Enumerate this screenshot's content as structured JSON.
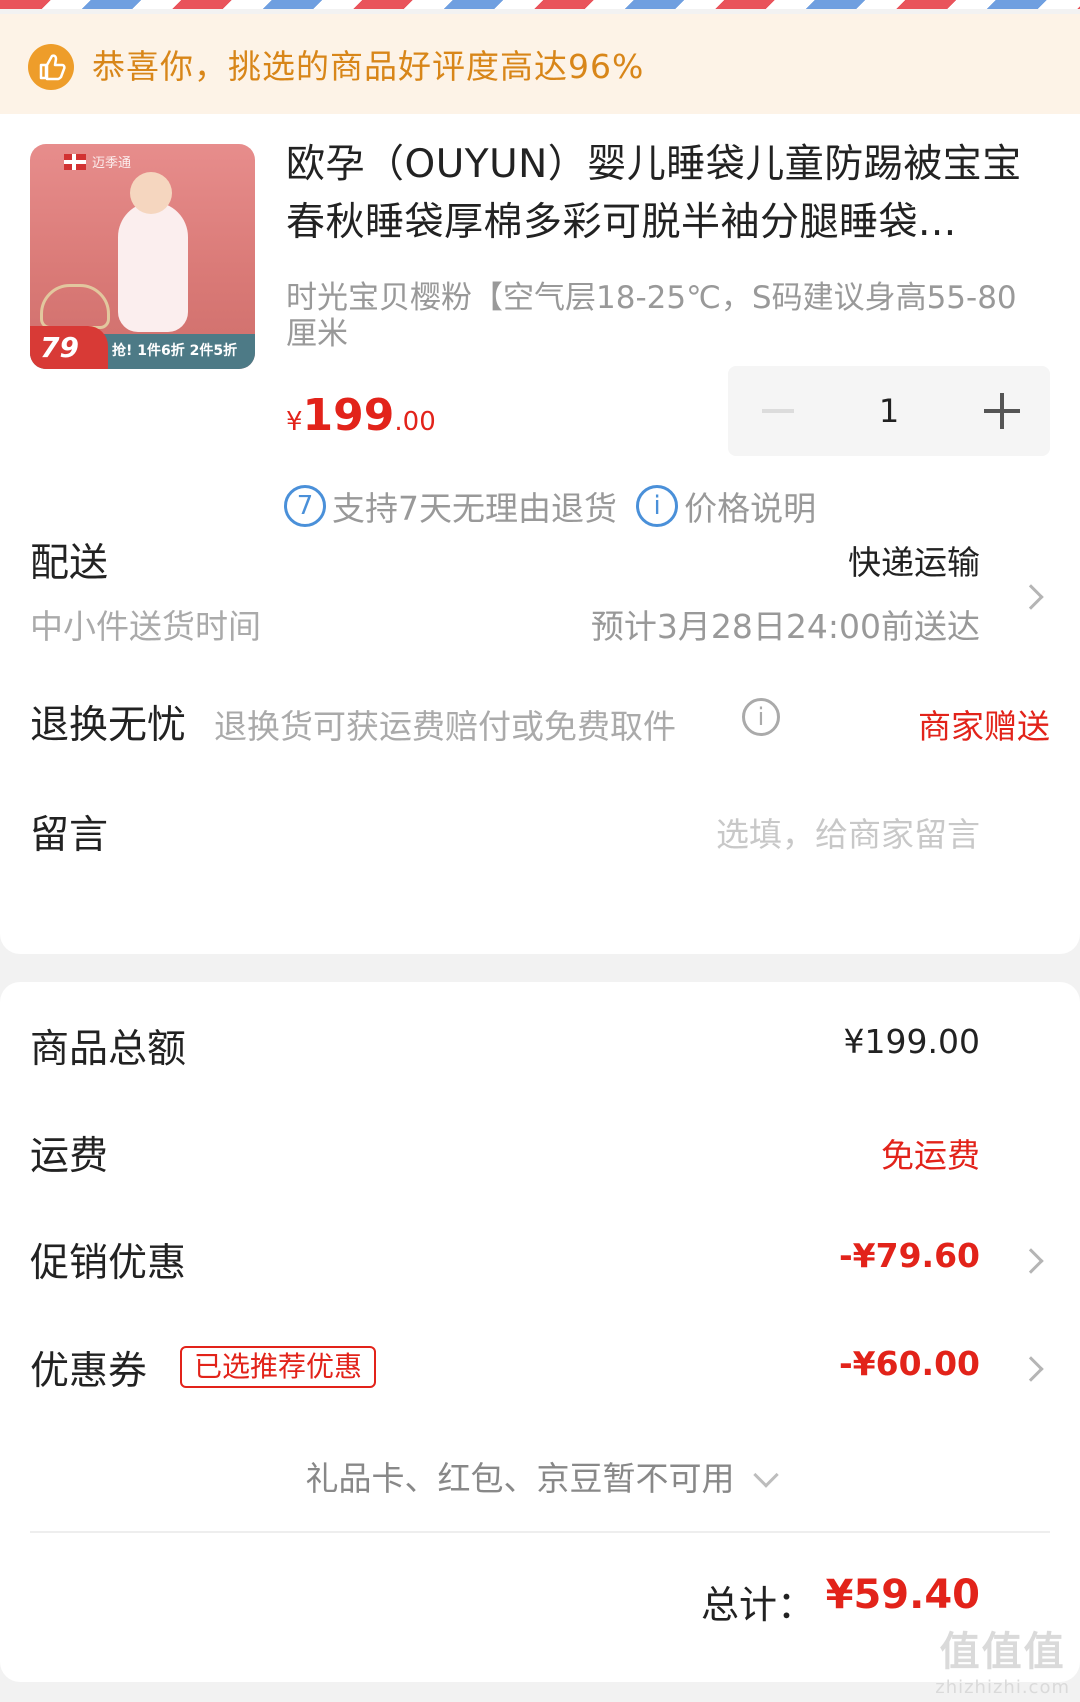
{
  "banner": {
    "text": "恭喜你，挑选的商品好评度高达96%"
  },
  "product": {
    "image_alt_text": "迈季通",
    "image_price": "79",
    "image_badge": "抢! 1件6折 2件5折",
    "title": "欧孕（OUYUN）婴儿睡袋儿童防踢被宝宝春秋睡袋厚棉多彩可脱半袖分腿睡袋...",
    "variant": "时光宝贝樱粉【空气层18-25℃，S码建议身高55-80厘米",
    "price_currency": "¥",
    "price_integer": "199",
    "price_decimal": ".00",
    "quantity": "1"
  },
  "services": [
    {
      "icon": "7",
      "label": "支持7天无理由退货"
    },
    {
      "icon": "i",
      "label": "价格说明"
    }
  ],
  "delivery": {
    "label": "配送",
    "method": "快递运输",
    "sub_label": "中小件送货时间",
    "estimate": "预计3月28日24:00前送达"
  },
  "returns": {
    "label": "退换无忧",
    "desc": "退换货可获运费赔付或免费取件",
    "value": "商家赠送"
  },
  "message": {
    "label": "留言",
    "placeholder": "选填，给商家留言"
  },
  "summary": {
    "goods_total_label": "商品总额",
    "goods_total_value": "¥199.00",
    "shipping_label": "运费",
    "shipping_value": "免运费",
    "promo_label": "促销优惠",
    "promo_value": "-¥79.60",
    "coupon_label": "优惠券",
    "coupon_tag": "已选推荐优惠",
    "coupon_value": "-¥60.00",
    "unavailable_note": "礼品卡、红包、京豆暂不可用",
    "total_label": "总计：",
    "total_value": "¥59.40"
  },
  "watermark": {
    "line1": "值值值",
    "line2": "zhizhizhi.com"
  },
  "colors": {
    "accent_red": "#e2231a",
    "banner_orange": "#d88619",
    "link_blue": "#4a90d9"
  }
}
